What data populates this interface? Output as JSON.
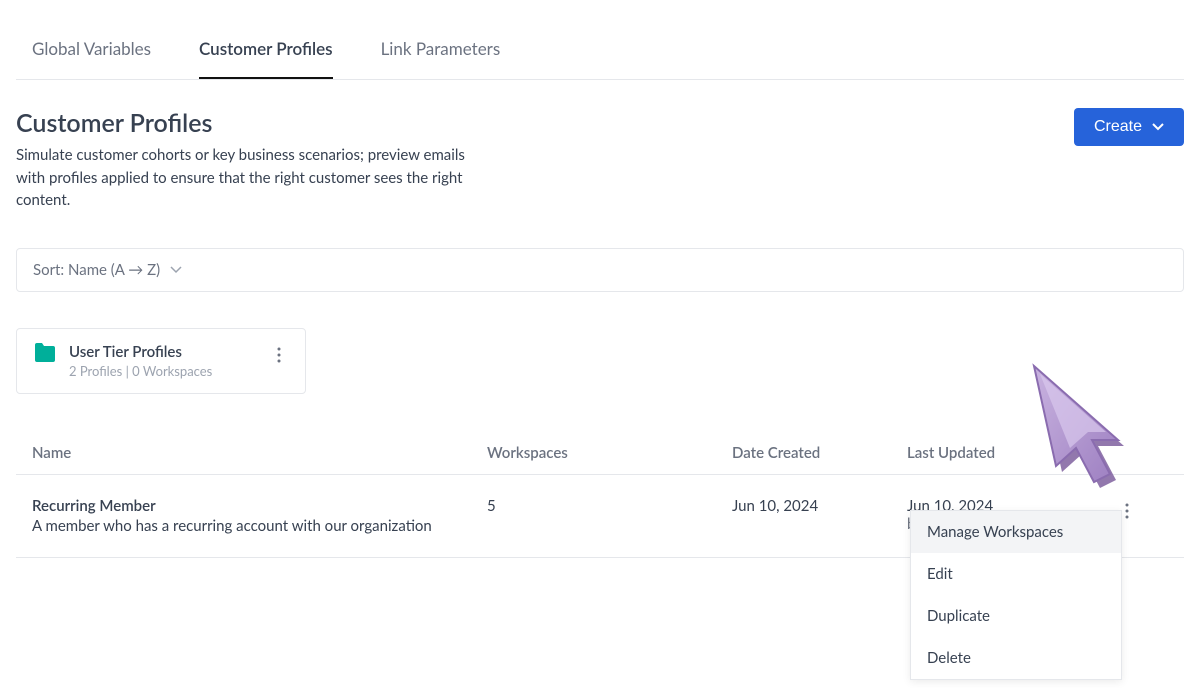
{
  "tabs": {
    "global_variables": "Global Variables",
    "customer_profiles": "Customer Profiles",
    "link_parameters": "Link Parameters"
  },
  "page": {
    "title": "Customer Profiles",
    "description": "Simulate customer cohorts or key business scenarios; preview emails with profiles applied to ensure that the right customer sees the right content."
  },
  "create_button": {
    "label": "Create"
  },
  "sort": {
    "label": "Sort: Name (A → Z)"
  },
  "folder": {
    "name": "User Tier Profiles",
    "meta": "2 Profiles   |   0 Workspaces"
  },
  "table": {
    "headers": {
      "name": "Name",
      "workspaces": "Workspaces",
      "date_created": "Date Created",
      "last_updated": "Last Updated"
    },
    "row": {
      "name": "Recurring Member",
      "desc": "A member who has a recurring account with our organization",
      "workspaces": "5",
      "date_created": "Jun 10, 2024",
      "updated_date": "Jun 10, 2024",
      "updated_by": "by User Name"
    }
  },
  "dropdown": {
    "manage_workspaces": "Manage Workspaces",
    "edit": "Edit",
    "duplicate": "Duplicate",
    "delete": "Delete"
  }
}
